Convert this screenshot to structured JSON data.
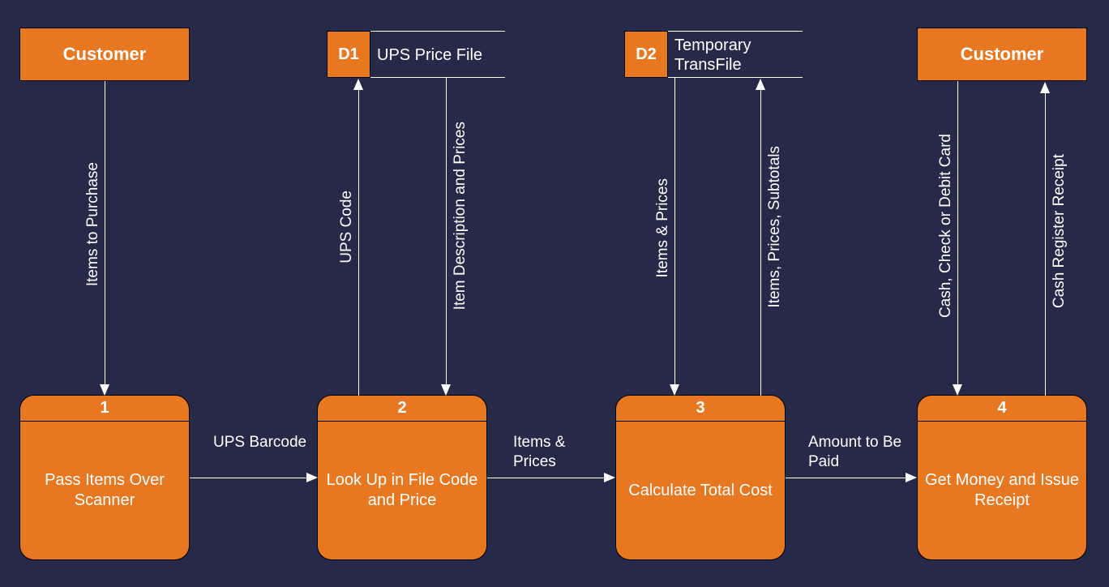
{
  "entities": {
    "customer_left": "Customer",
    "customer_right": "Customer"
  },
  "datastores": {
    "d1": {
      "num": "D1",
      "label": "UPS Price File"
    },
    "d2": {
      "num": "D2",
      "label": "Temporary TransFile"
    }
  },
  "processes": {
    "p1": {
      "num": "1",
      "label": "Pass Items Over Scanner"
    },
    "p2": {
      "num": "2",
      "label": "Look Up in File Code and Price"
    },
    "p3": {
      "num": "3",
      "label": "Calculate Total Cost"
    },
    "p4": {
      "num": "4",
      "label": "Get Money and Issue Receipt"
    }
  },
  "flows": {
    "f1": "Items to Purchase",
    "f2": "UPS Code",
    "f3": "Item Description and Prices",
    "f4": "Items & Prices",
    "f5": "Items, Prices, Subtotals",
    "f6": "Cash, Check or Debit Card",
    "f7": "Cash Register Receipt",
    "h1": "UPS Barcode",
    "h2": "Items & Prices",
    "h3": "Amount to Be Paid"
  }
}
